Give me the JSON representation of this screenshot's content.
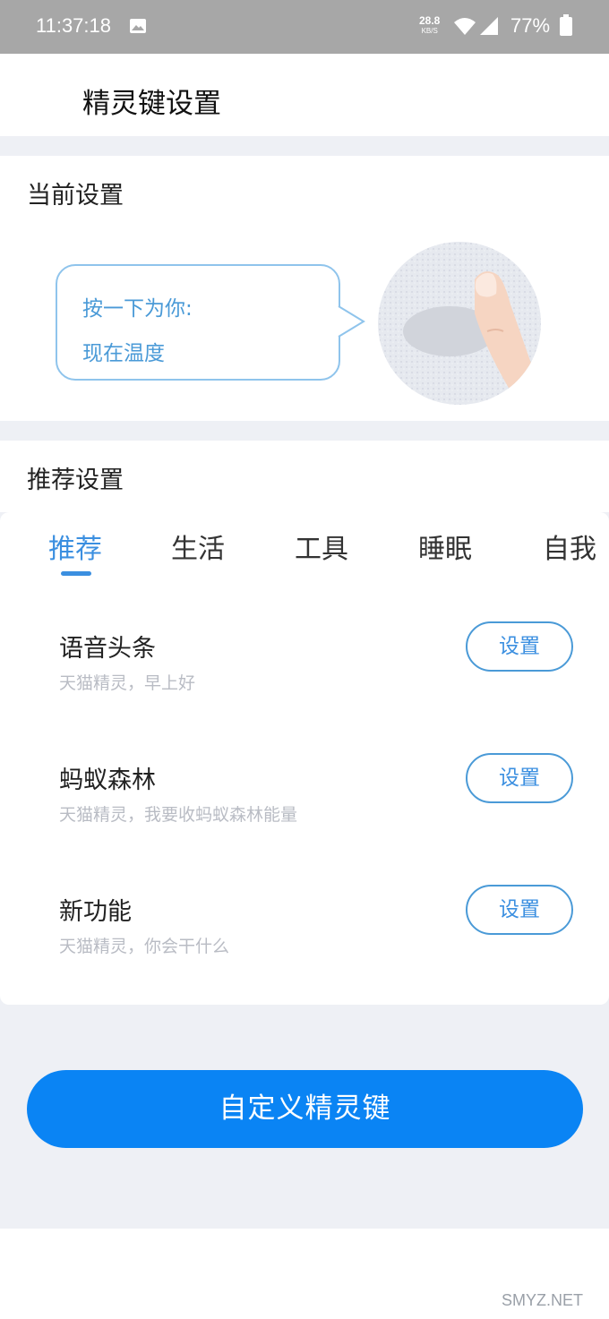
{
  "status_bar": {
    "time": "11:37:18",
    "net_speed": "28.8",
    "net_speed_unit": "KB/S",
    "battery": "77%"
  },
  "header": {
    "title": "精灵键设置"
  },
  "current": {
    "section_title": "当前设置",
    "bubble_line1": "按一下为你:",
    "bubble_line2": "现在温度"
  },
  "recommend": {
    "section_title": "推荐设置",
    "tabs": [
      {
        "label": "推荐",
        "active": true
      },
      {
        "label": "生活",
        "active": false
      },
      {
        "label": "工具",
        "active": false
      },
      {
        "label": "睡眠",
        "active": false
      },
      {
        "label": "自我",
        "active": false
      }
    ],
    "items": [
      {
        "name": "语音头条",
        "desc": "天猫精灵，早上好",
        "button": "设置"
      },
      {
        "name": "蚂蚁森林",
        "desc": "天猫精灵，我要收蚂蚁森林能量",
        "button": "设置"
      },
      {
        "name": "新功能",
        "desc": "天猫精灵，你会干什么",
        "button": "设置"
      }
    ]
  },
  "custom_button": "自定义精灵键",
  "watermark": "SMYZ.NET",
  "colors": {
    "accent": "#0a84f4",
    "accent_text": "#3b8fe0",
    "status_bar": "#a7a7a7"
  }
}
